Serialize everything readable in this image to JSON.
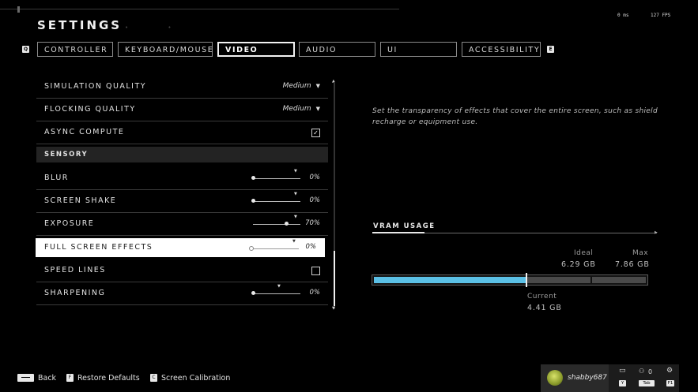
{
  "header": {
    "title": "SETTINGS",
    "latency": "0 ms",
    "fps": "127 FPS"
  },
  "tabs": {
    "prev_key": "Q",
    "next_key": "E",
    "items": [
      {
        "label": "CONTROLLER"
      },
      {
        "label": "KEYBOARD/MOUSE"
      },
      {
        "label": "VIDEO"
      },
      {
        "label": "AUDIO"
      },
      {
        "label": "UI"
      },
      {
        "label": "ACCESSIBILITY"
      }
    ],
    "active": "VIDEO"
  },
  "settings": {
    "simulation_quality": {
      "label": "SIMULATION QUALITY",
      "value": "Medium",
      "caret": "▼"
    },
    "flocking_quality": {
      "label": "FLOCKING QUALITY",
      "value": "Medium",
      "caret": "▼"
    },
    "async_compute": {
      "label": "ASYNC COMPUTE",
      "checked": true,
      "mark": "✓"
    },
    "section_sensory": {
      "label": "SENSORY"
    },
    "blur": {
      "label": "BLUR",
      "value": "0%",
      "level": 0.0,
      "default_level": 0.9
    },
    "screen_shake": {
      "label": "SCREEN SHAKE",
      "value": "0%",
      "level": 0.0,
      "default_level": 0.9
    },
    "exposure": {
      "label": "EXPOSURE",
      "value": "70%",
      "level": 0.7,
      "default_level": 0.9
    },
    "full_screen_effects": {
      "label": "FULL SCREEN EFFECTS",
      "value": "0%",
      "level": 0.0,
      "default_level": 0.9
    },
    "speed_lines": {
      "label": "SPEED LINES",
      "checked": false
    },
    "sharpening": {
      "label": "SHARPENING",
      "value": "0%",
      "level": 0.0,
      "default_level": 0.55
    }
  },
  "description": "Set the transparency of effects that cover the entire screen, such as shield recharge or equipment use.",
  "vram": {
    "title": "VRAM USAGE",
    "ideal_label": "Ideal",
    "ideal_value": "6.29 GB",
    "max_label": "Max",
    "max_value": "7.86 GB",
    "current_label": "Current",
    "current_value": "4.41 GB",
    "current_gb": 4.41,
    "ideal_gb": 6.29,
    "max_gb": 7.86
  },
  "footer": {
    "back_label": "Back",
    "restore_key": "F",
    "restore_label": "Restore Defaults",
    "calibration_key": "C",
    "calibration_label": "Screen Calibration"
  },
  "player": {
    "name": "shabby687",
    "chat_key": "Y",
    "party_count": "0",
    "party_key": "Tab",
    "settings_key": "F1"
  },
  "colors": {
    "accent": "#5bc0e6",
    "background": "#000000"
  }
}
